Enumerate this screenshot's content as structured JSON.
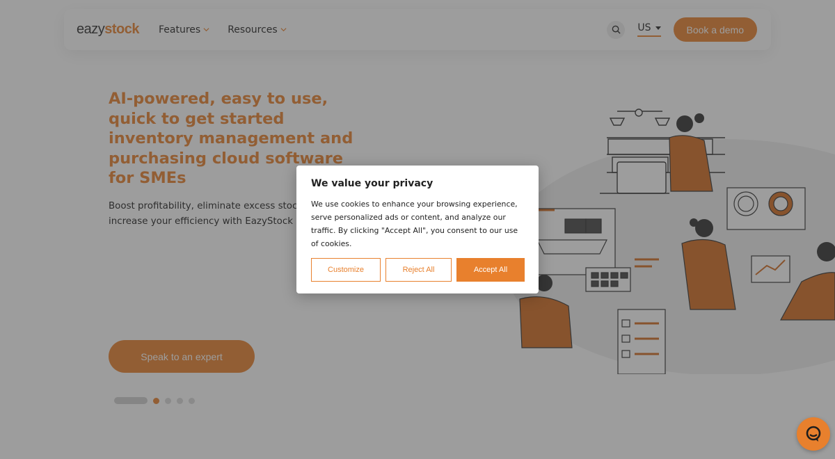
{
  "header": {
    "logo_part1": "eazy",
    "logo_part2": "stock",
    "nav": [
      {
        "label": "Features"
      },
      {
        "label": "Resources"
      }
    ],
    "language": "US",
    "demo_button": "Book a demo"
  },
  "hero": {
    "title": "AI-powered, easy to use, quick to get started inventory management and purchasing cloud software for SMEs",
    "subtitle_line1": "Boost profitability, eliminate excess stock",
    "subtitle_line2": "increase your efficiency with EazyStock",
    "cta_button": "Speak to an expert"
  },
  "cookie_modal": {
    "title": "We value your privacy",
    "text": "We use cookies to enhance your browsing experience, serve personalized ads or content, and analyze our traffic. By clicking \"Accept All\", you consent to our use of cookies.",
    "customize_button": "Customize",
    "reject_button": "Reject All",
    "accept_button": "Accept All"
  },
  "carousel": {
    "active_index": 1,
    "dot_count": 4
  },
  "colors": {
    "accent": "#e8802d",
    "overlay": "rgba(60,60,60,0.5)"
  },
  "icons": {
    "search": "search-icon",
    "chat": "chat-icon",
    "chevron": "chevron-down-icon"
  }
}
